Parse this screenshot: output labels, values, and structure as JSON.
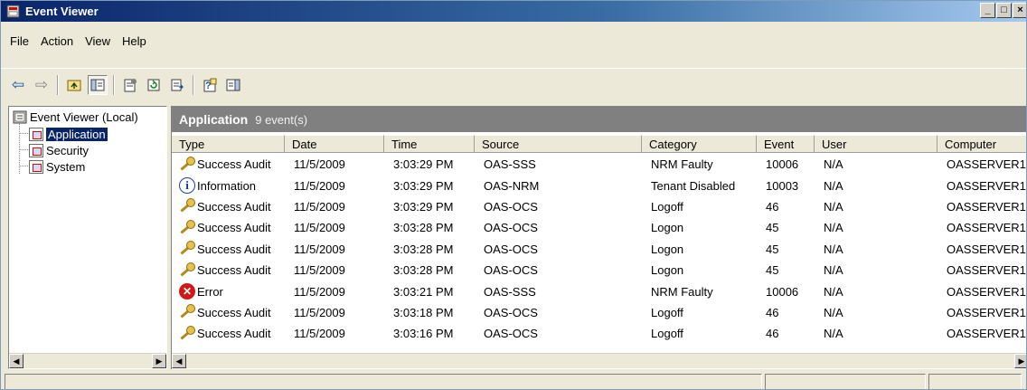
{
  "window": {
    "title": "Event Viewer",
    "controls": {
      "minimize": "_",
      "maximize": "□",
      "close": "×"
    }
  },
  "menubar": {
    "items": [
      {
        "label": "File"
      },
      {
        "label": "Action"
      },
      {
        "label": "View"
      },
      {
        "label": "Help"
      }
    ]
  },
  "toolbar": {
    "buttons": [
      {
        "icon": "back-arrow-icon",
        "glyph": "⇦"
      },
      {
        "icon": "forward-arrow-icon",
        "glyph": "⇨"
      },
      {
        "icon": "up-one-level-icon",
        "glyph": ""
      },
      {
        "icon": "show-hide-tree-icon",
        "glyph": ""
      },
      {
        "icon": "properties-icon",
        "glyph": ""
      },
      {
        "icon": "refresh-icon",
        "glyph": ""
      },
      {
        "icon": "export-list-icon",
        "glyph": ""
      },
      {
        "icon": "help-icon",
        "glyph": ""
      },
      {
        "icon": "show-hide-action-pane-icon",
        "glyph": ""
      }
    ]
  },
  "tree": {
    "root": {
      "label": "Event Viewer (Local)",
      "icon": "event-viewer-icon"
    },
    "children": [
      {
        "label": "Application",
        "icon": "log-icon",
        "selected": true
      },
      {
        "label": "Security",
        "icon": "log-icon",
        "selected": false
      },
      {
        "label": "System",
        "icon": "log-icon",
        "selected": false
      }
    ]
  },
  "list": {
    "title": "Application",
    "count": "9 event(s)",
    "columns": [
      "Type",
      "Date",
      "Time",
      "Source",
      "Category",
      "Event",
      "User",
      "Computer"
    ],
    "rows": [
      {
        "icon": "key-icon",
        "type": "Success Audit",
        "date": "11/5/2009",
        "time": "3:03:29 PM",
        "source": "OAS-SSS",
        "category": "NRM Faulty",
        "event": "10006",
        "user": "N/A",
        "computer": "OASSERVER1"
      },
      {
        "icon": "info-icon",
        "type": "Information",
        "date": "11/5/2009",
        "time": "3:03:29 PM",
        "source": "OAS-NRM",
        "category": "Tenant Disabled",
        "event": "10003",
        "user": "N/A",
        "computer": "OASSERVER1"
      },
      {
        "icon": "key-icon",
        "type": "Success Audit",
        "date": "11/5/2009",
        "time": "3:03:29 PM",
        "source": "OAS-OCS",
        "category": "Logoff",
        "event": "46",
        "user": "N/A",
        "computer": "OASSERVER1"
      },
      {
        "icon": "key-icon",
        "type": "Success Audit",
        "date": "11/5/2009",
        "time": "3:03:28 PM",
        "source": "OAS-OCS",
        "category": "Logon",
        "event": "45",
        "user": "N/A",
        "computer": "OASSERVER1"
      },
      {
        "icon": "key-icon",
        "type": "Success Audit",
        "date": "11/5/2009",
        "time": "3:03:28 PM",
        "source": "OAS-OCS",
        "category": "Logon",
        "event": "45",
        "user": "N/A",
        "computer": "OASSERVER1"
      },
      {
        "icon": "key-icon",
        "type": "Success Audit",
        "date": "11/5/2009",
        "time": "3:03:28 PM",
        "source": "OAS-OCS",
        "category": "Logon",
        "event": "45",
        "user": "N/A",
        "computer": "OASSERVER1"
      },
      {
        "icon": "error-icon",
        "type": "Error",
        "date": "11/5/2009",
        "time": "3:03:21 PM",
        "source": "OAS-SSS",
        "category": "NRM Faulty",
        "event": "10006",
        "user": "N/A",
        "computer": "OASSERVER1"
      },
      {
        "icon": "key-icon",
        "type": "Success Audit",
        "date": "11/5/2009",
        "time": "3:03:18 PM",
        "source": "OAS-OCS",
        "category": "Logoff",
        "event": "46",
        "user": "N/A",
        "computer": "OASSERVER1"
      },
      {
        "icon": "key-icon",
        "type": "Success Audit",
        "date": "11/5/2009",
        "time": "3:03:16 PM",
        "source": "OAS-OCS",
        "category": "Logoff",
        "event": "46",
        "user": "N/A",
        "computer": "OASSERVER1"
      }
    ]
  },
  "statusbar": {
    "panels": [
      "",
      "",
      ""
    ]
  }
}
